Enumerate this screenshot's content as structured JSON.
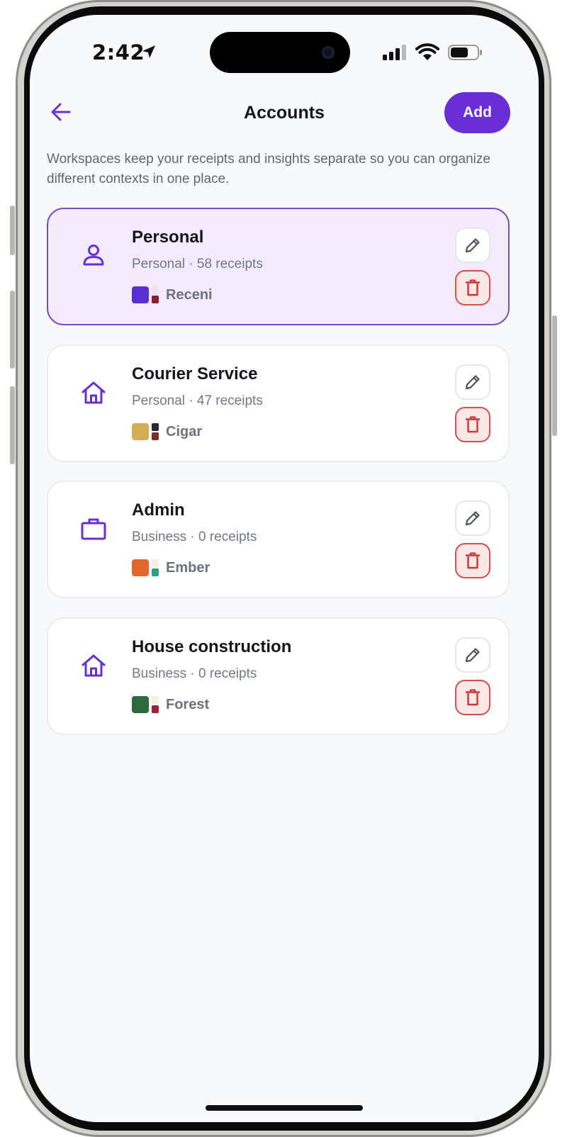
{
  "status_bar": {
    "time": "2:42"
  },
  "header": {
    "title": "Accounts",
    "add_label": "Add"
  },
  "intro": "Workspaces keep your receipts and insights separate so you can organize different contexts in one place.",
  "accounts": [
    {
      "name": "Personal",
      "meta": "Personal · 58 receipts",
      "theme": "Receni",
      "icon": "person-icon",
      "colors": {
        "main": "#5b2fd1",
        "top": "#e9e1f6",
        "bottom": "#8c1d2e"
      },
      "selected": true
    },
    {
      "name": "Courier Service",
      "meta": "Personal · 47 receipts",
      "theme": "Cigar",
      "icon": "home-icon",
      "colors": {
        "main": "#d3ac55",
        "top": "#2a2a2a",
        "bottom": "#7a2e2e"
      },
      "selected": false
    },
    {
      "name": "Admin",
      "meta": "Business · 0 receipts",
      "theme": "Ember",
      "icon": "briefcase-icon",
      "colors": {
        "main": "#e2672c",
        "top": "#f6ece4",
        "bottom": "#2f9f84"
      },
      "selected": false
    },
    {
      "name": "House construction",
      "meta": "Business · 0 receipts",
      "theme": "Forest",
      "icon": "home-icon",
      "colors": {
        "main": "#2c6a3b",
        "top": "#eef3dd",
        "bottom": "#a11d3c"
      },
      "selected": false
    }
  ],
  "colors": {
    "accent": "#6a2ed6",
    "danger": "#d94d4d",
    "background": "#f8f9fb"
  }
}
